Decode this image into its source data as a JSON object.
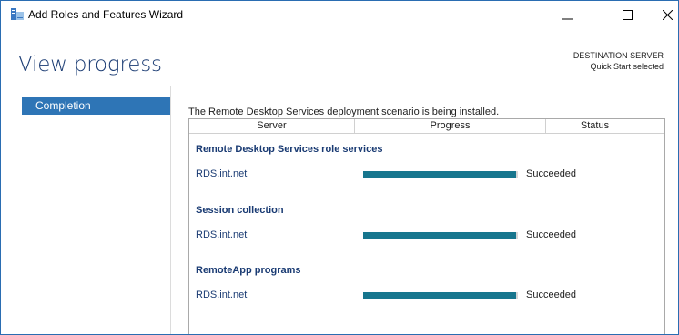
{
  "window": {
    "title": "Add Roles and Features Wizard",
    "accent_color": "#2e75b6"
  },
  "header": {
    "page_title": "View progress",
    "destination_label": "DESTINATION SERVER",
    "destination_value": "Quick Start selected"
  },
  "sidebar": {
    "items": [
      {
        "label": "Completion",
        "selected": true
      }
    ]
  },
  "main": {
    "intro": "The Remote Desktop Services deployment scenario is being installed.",
    "columns": [
      "Server",
      "Progress",
      "Status"
    ],
    "groups": [
      {
        "title": "Remote Desktop Services role services",
        "rows": [
          {
            "server": "RDS.int.net",
            "progress": 1.0,
            "status": "Succeeded"
          }
        ]
      },
      {
        "title": "Session collection",
        "rows": [
          {
            "server": "RDS.int.net",
            "progress": 1.0,
            "status": "Succeeded"
          }
        ]
      },
      {
        "title": "RemoteApp programs",
        "rows": [
          {
            "server": "RDS.int.net",
            "progress": 1.0,
            "status": "Succeeded"
          }
        ]
      }
    ],
    "progress_color": "#17768e"
  },
  "icons": {
    "app": "server-manager-icon",
    "minimize": "minimize-icon",
    "maximize": "maximize-icon",
    "close": "close-icon"
  }
}
